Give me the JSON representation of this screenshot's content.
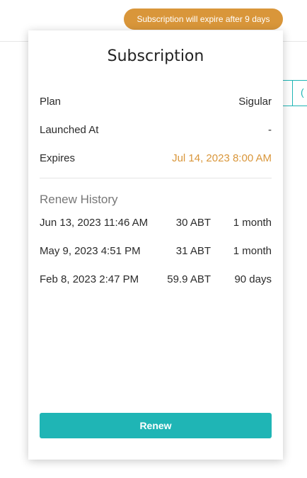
{
  "badge": {
    "text": "Subscription will expire after 9 days"
  },
  "background": {
    "partial_button_glyph": "("
  },
  "card": {
    "title": "Subscription",
    "plan": {
      "label": "Plan",
      "value": "Sigular"
    },
    "launched_at": {
      "label": "Launched At",
      "value": "-"
    },
    "expires": {
      "label": "Expires",
      "value": "Jul 14, 2023 8:00 AM"
    },
    "renew_history": {
      "heading": "Renew History",
      "rows": [
        {
          "date": "Jun 13, 2023 11:46 AM",
          "amount": "30 ABT",
          "duration": "1 month"
        },
        {
          "date": "May 9, 2023 4:51 PM",
          "amount": "31 ABT",
          "duration": "1 month"
        },
        {
          "date": "Feb 8, 2023 2:47 PM",
          "amount": "59.9 ABT",
          "duration": "90 days"
        }
      ]
    },
    "renew_button": "Renew"
  },
  "colors": {
    "badge": "#d9963a",
    "accent": "#1fb5b5",
    "warning_text": "#d9963a"
  }
}
